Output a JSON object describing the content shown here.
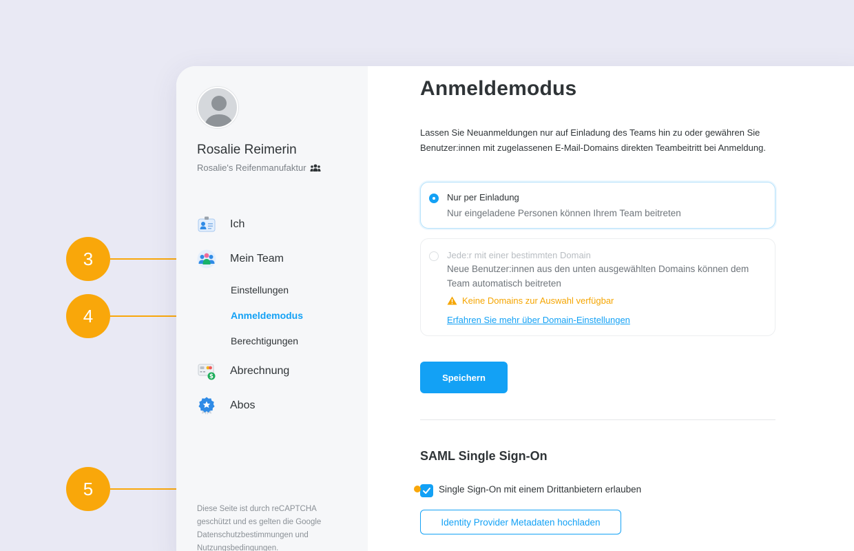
{
  "user": {
    "name": "Rosalie Reimerin",
    "organization": "Rosalie's Reifenmanufaktur"
  },
  "nav": {
    "ich": "Ich",
    "mein_team": "Mein Team",
    "einstellungen": "Einstellungen",
    "anmeldemodus": "Anmeldemodus",
    "berechtigungen": "Berechtigungen",
    "abrechnung": "Abrechnung",
    "abos": "Abos"
  },
  "recaptcha_text": "Diese Seite ist durch reCAPTCHA geschützt und es gelten die Google Datenschutzbestimmungen und Nutzungsbedingungen.",
  "main": {
    "title": "Anmeldemodus",
    "description": "Lassen Sie Neuanmeldungen nur auf Einladung des Teams hin zu oder gewähren Sie Benutzer:innen mit zugelassenen E-Mail-Domains direkten Teambeitritt bei Anmeldung.",
    "option_invite": {
      "title": "Nur per Einladung",
      "description": "Nur eingeladene Personen können Ihrem Team beitreten",
      "selected": true
    },
    "option_domain": {
      "title": "Jede:r mit einer bestimmten Domain",
      "description": "Neue Benutzer:innen aus den unten ausgewählten Domains können dem Team automatisch beitreten",
      "warning": "Keine Domains zur Auswahl verfügbar",
      "link": "Erfahren Sie mehr über Domain-Einstellungen",
      "selected": false
    },
    "save_label": "Speichern",
    "saml_title": "SAML Single Sign-On",
    "sso_checkbox_label": "Single Sign-On mit einem Drittanbietern erlauben",
    "sso_checked": true,
    "metadata_button": "Identity Provider Metadaten hochladen"
  },
  "callouts": [
    "3",
    "4",
    "5"
  ],
  "colors": {
    "accent": "#13a1f5",
    "callout": "#f9a70a",
    "warning": "#f5a500",
    "background": "#e9e9f4"
  }
}
